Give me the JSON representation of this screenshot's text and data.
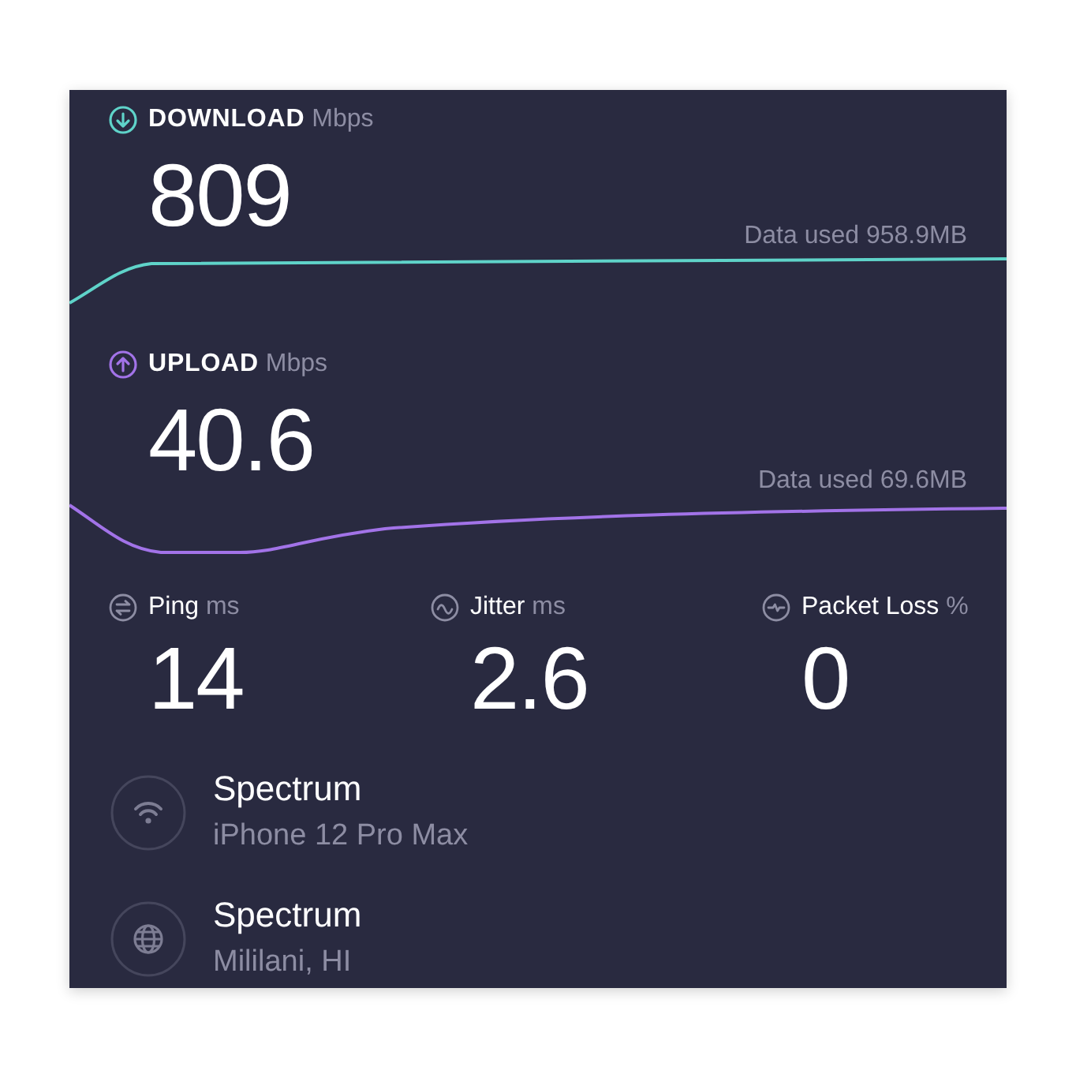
{
  "results": [
    {
      "kind": "download",
      "label": "DOWNLOAD",
      "unit": "Mbps",
      "value": "809",
      "data_used": "Data used 958.9MB",
      "color": "#5fd3c9"
    },
    {
      "kind": "upload",
      "label": "UPLOAD",
      "unit": "Mbps",
      "value": "40.6",
      "data_used": "Data used 69.6MB",
      "color": "#a273e8"
    }
  ],
  "metrics": [
    {
      "kind": "ping",
      "label": "Ping",
      "unit": "ms",
      "value": "14"
    },
    {
      "kind": "jitter",
      "label": "Jitter",
      "unit": "ms",
      "value": "2.6"
    },
    {
      "kind": "packet_loss",
      "label": "Packet Loss",
      "unit": "%",
      "value": "0"
    }
  ],
  "connections": [
    {
      "kind": "wifi",
      "name": "Spectrum",
      "detail": "iPhone 12 Pro Max"
    },
    {
      "kind": "globe",
      "name": "Spectrum",
      "detail": "Mililani, HI"
    }
  ]
}
